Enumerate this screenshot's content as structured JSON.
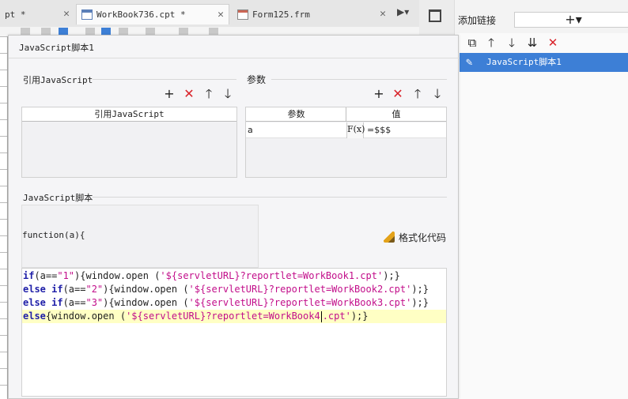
{
  "tabs": [
    {
      "label": "pt *",
      "icon": "workbook-icon",
      "active": false
    },
    {
      "label": "WorkBook736.cpt *",
      "icon": "workbook-icon",
      "active": true
    },
    {
      "label": "Form125.frm",
      "icon": "form-icon",
      "active": false
    }
  ],
  "right_panel": {
    "title": "添加链接",
    "add_label": "+▾",
    "tools": [
      "copy-icon",
      "arrow-up-icon",
      "arrow-down-icon",
      "sort-down-icon",
      "delete-icon"
    ],
    "selected_item": "JavaScript脚本1"
  },
  "dialog": {
    "title": "JavaScript脚本1",
    "ref_section": {
      "label": "引用JavaScript",
      "column": "引用JavaScript"
    },
    "param_section": {
      "label": "参数",
      "columns": [
        "参数",
        "值"
      ],
      "rows": [
        {
          "name": "a",
          "fx": "F(x)",
          "value": "=$$$"
        }
      ]
    },
    "script_section": {
      "label": "JavaScript脚本",
      "function_header": "function(a){",
      "format_button": "格式化代码"
    }
  },
  "code_lines": [
    [
      {
        "t": "kw",
        "v": "if"
      },
      {
        "t": "plain",
        "v": "(a=="
      },
      {
        "t": "str",
        "v": "\"1\""
      },
      {
        "t": "plain",
        "v": "){window.open ("
      },
      {
        "t": "str",
        "v": "'${servletURL}?reportlet=WorkBook1.cpt'"
      },
      {
        "t": "plain",
        "v": ");}"
      }
    ],
    [
      {
        "t": "kw",
        "v": "else if"
      },
      {
        "t": "plain",
        "v": "(a=="
      },
      {
        "t": "str",
        "v": "\"2\""
      },
      {
        "t": "plain",
        "v": "){window.open ("
      },
      {
        "t": "str",
        "v": "'${servletURL}?reportlet=WorkBook2.cpt'"
      },
      {
        "t": "plain",
        "v": ");}"
      }
    ],
    [
      {
        "t": "kw",
        "v": "else if"
      },
      {
        "t": "plain",
        "v": "(a=="
      },
      {
        "t": "str",
        "v": "\"3\""
      },
      {
        "t": "plain",
        "v": "){window.open ("
      },
      {
        "t": "str",
        "v": "'${servletURL}?reportlet=WorkBook3.cpt'"
      },
      {
        "t": "plain",
        "v": ");}"
      }
    ],
    [
      {
        "t": "kw",
        "v": "else"
      },
      {
        "t": "plain",
        "v": "{window.open ("
      },
      {
        "t": "str",
        "v": "'${servletURL}?reportlet=WorkBook4"
      },
      {
        "t": "caret",
        "v": ""
      },
      {
        "t": "str",
        "v": ".cpt'"
      },
      {
        "t": "plain",
        "v": ");}"
      }
    ]
  ],
  "current_line": 3
}
